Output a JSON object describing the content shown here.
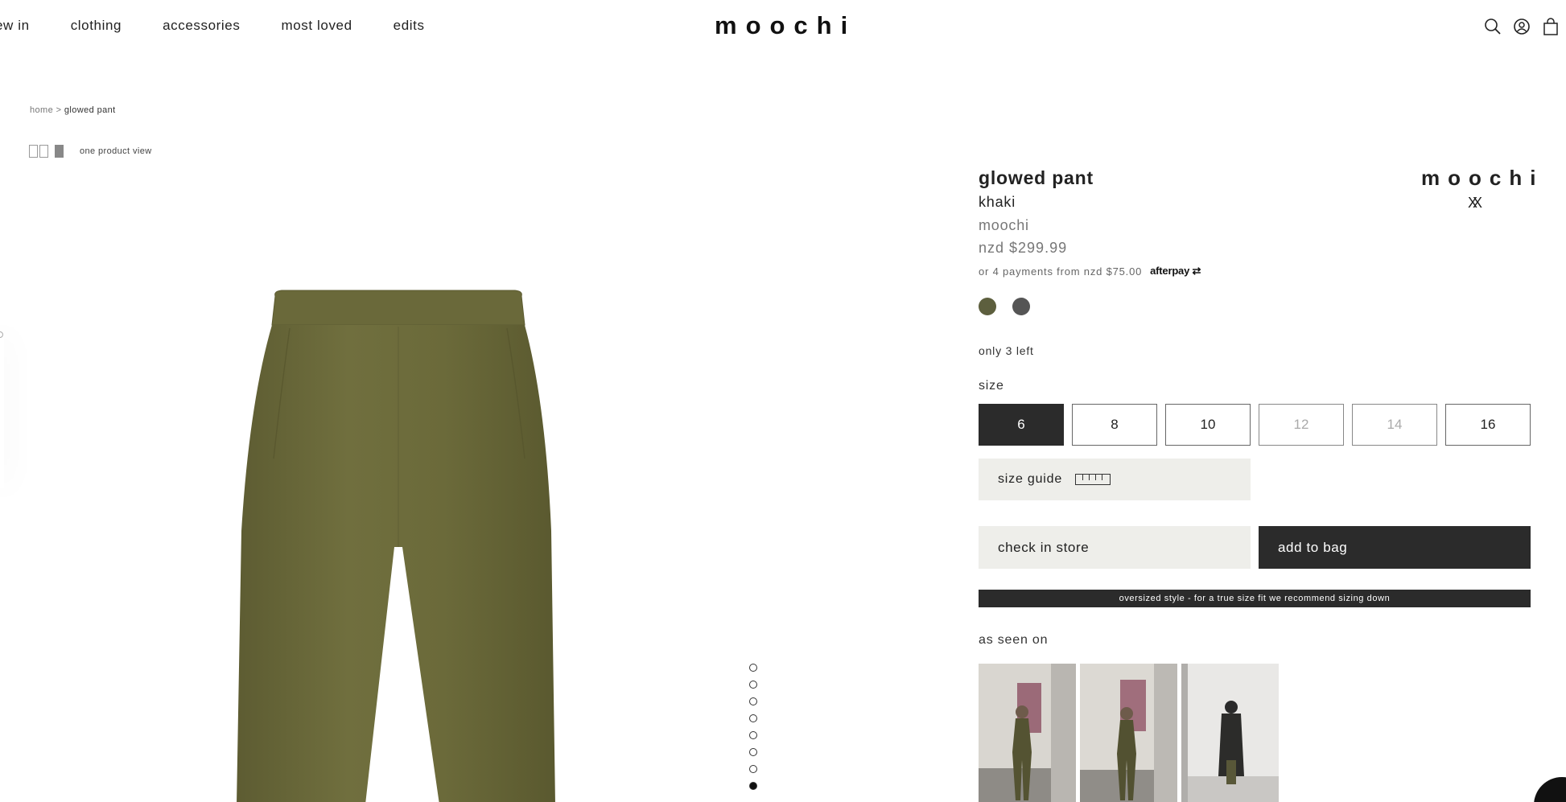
{
  "header": {
    "nav": [
      {
        "label": "ew in"
      },
      {
        "label": "clothing"
      },
      {
        "label": "accessories"
      },
      {
        "label": "most loved"
      },
      {
        "label": "edits"
      }
    ],
    "logo": "moochi",
    "icons": [
      "search-icon",
      "account-icon",
      "bag-icon"
    ]
  },
  "breadcrumb": {
    "home": "home",
    "separator": ">",
    "current": "glowed pant"
  },
  "view": {
    "label": "one product view",
    "icons": [
      "two-column-view-icon",
      "single-view-icon"
    ]
  },
  "product": {
    "title": "glowed pant",
    "colour": "khaki",
    "brand": "moochi",
    "price": "nzd $299.99",
    "installment": "or 4 payments from nzd $75.00",
    "afterpay": "afterpay",
    "brand_mark": "moochi",
    "brand_mark_sub": "XX",
    "swatches": [
      {
        "name": "khaki",
        "color": "#5d5f3e"
      },
      {
        "name": "charcoal",
        "color": "#555555"
      }
    ],
    "stock": "only 3 left",
    "size_label": "size",
    "sizes": [
      {
        "label": "6",
        "state": "selected"
      },
      {
        "label": "8",
        "state": "available"
      },
      {
        "label": "10",
        "state": "available"
      },
      {
        "label": "12",
        "state": "unavailable"
      },
      {
        "label": "14",
        "state": "unavailable"
      },
      {
        "label": "16",
        "state": "available"
      }
    ],
    "size_guide": "size guide",
    "check_store": "check in store",
    "add_to_bag": "add to bag",
    "fit_note": "oversized style - for a true size fit we recommend sizing down",
    "as_seen_on": "as seen on",
    "gallery": {
      "count": 8,
      "active_index": 8
    }
  },
  "colors": {
    "accent": "#2b2b2b",
    "light_button": "#eeeeea",
    "pant": "#6b6a3a"
  }
}
